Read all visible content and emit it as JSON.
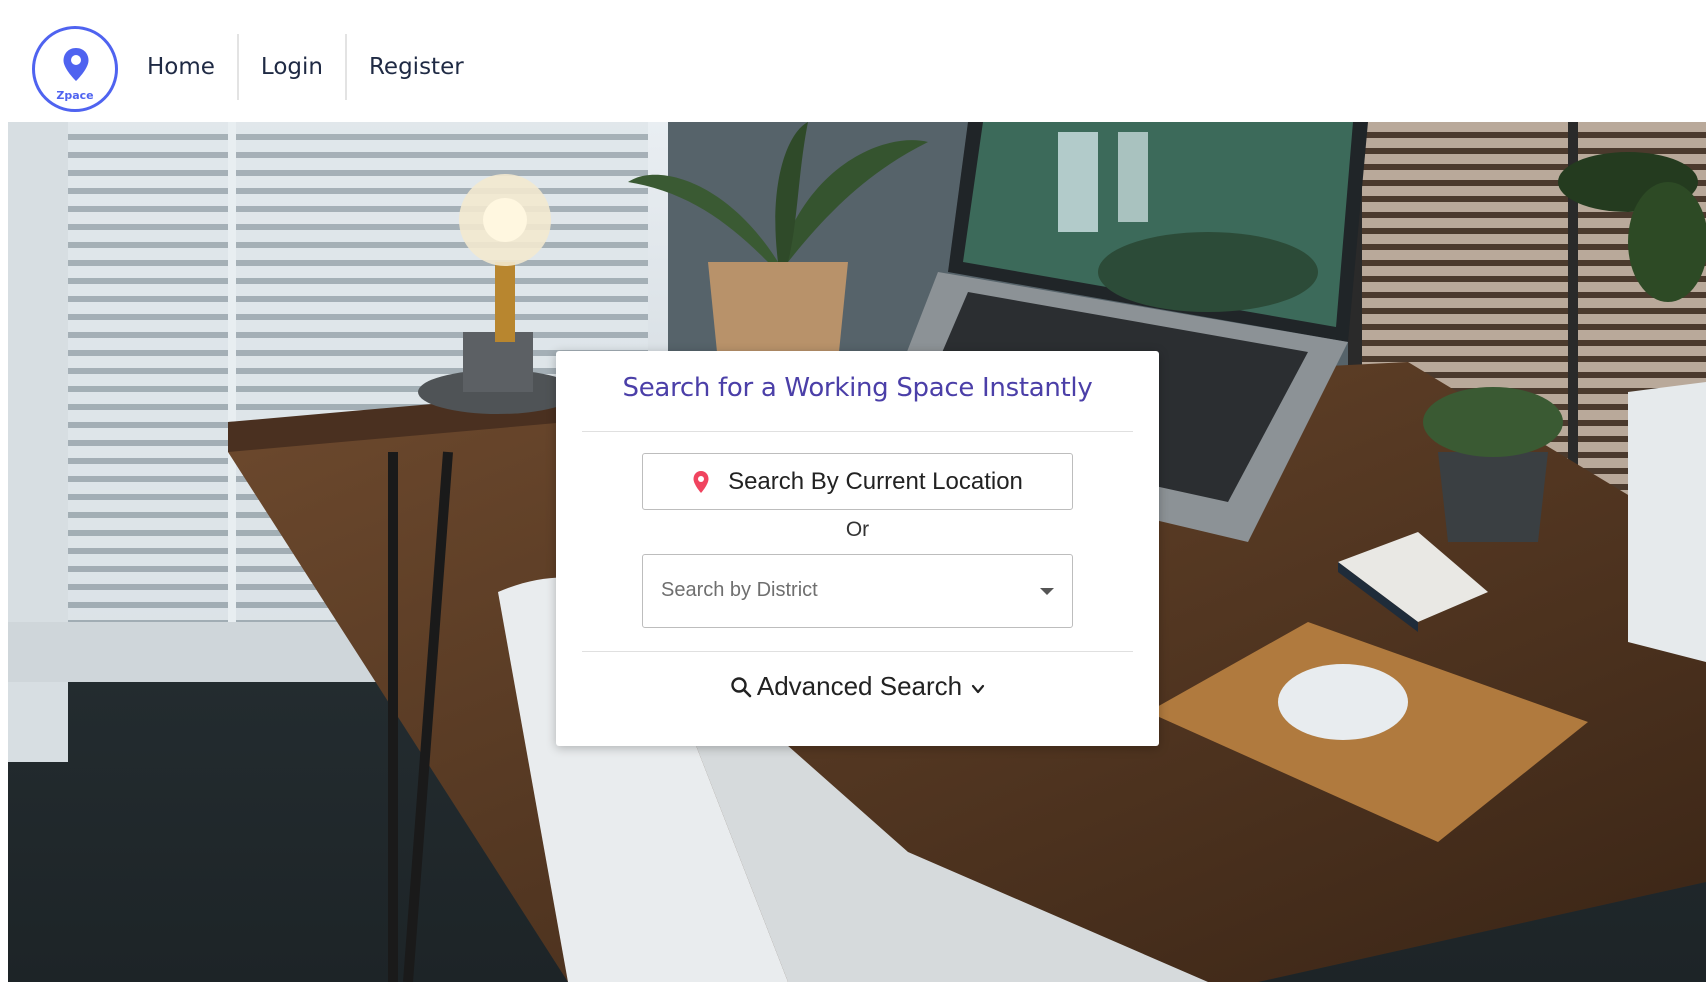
{
  "logo": {
    "text": "Zpace"
  },
  "nav": {
    "items": [
      {
        "label": "Home"
      },
      {
        "label": "Login"
      },
      {
        "label": "Register"
      }
    ]
  },
  "search_card": {
    "title": "Search for a Working Space Instantly",
    "location_button_label": "Search By Current Location",
    "or_text": "Or",
    "district_placeholder": "Search by District",
    "advanced_search_label": "Advanced Search"
  },
  "colors": {
    "brand": "#4f63f0",
    "title": "#4b3fa8",
    "pin": "#f0445f"
  },
  "icons": [
    "map-pin-icon",
    "location-pin-icon",
    "dropdown-caret-icon",
    "search-icon",
    "chevron-down-icon"
  ],
  "hero": {
    "description": "desk workspace photo with laptop, lamp and plants"
  }
}
